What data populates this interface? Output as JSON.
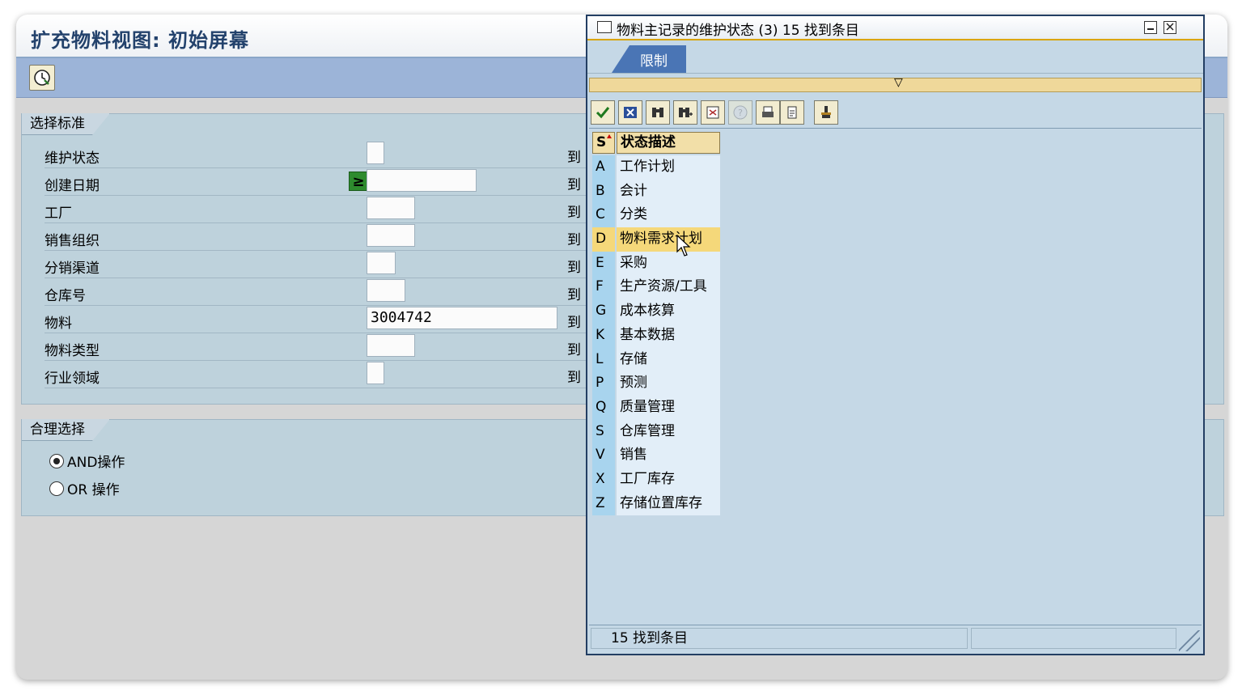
{
  "window": {
    "title": "扩充物料视图: 初始屏幕"
  },
  "toolbar": {
    "execute_icon": "clock-execute-icon"
  },
  "selection_criteria": {
    "group_title": "选择标准",
    "to_label": "到",
    "rows": [
      {
        "label": "维护状态",
        "value": ""
      },
      {
        "label": "创建日期",
        "value": "",
        "operator": "≥"
      },
      {
        "label": "工厂",
        "value": ""
      },
      {
        "label": "销售组织",
        "value": ""
      },
      {
        "label": "分销渠道",
        "value": ""
      },
      {
        "label": "仓库号",
        "value": ""
      },
      {
        "label": "物料",
        "value": "3004742"
      },
      {
        "label": "物料类型",
        "value": ""
      },
      {
        "label": "行业领域",
        "value": ""
      }
    ]
  },
  "logical_selection": {
    "group_title": "合理选择",
    "options": [
      {
        "label": "AND操作",
        "selected": true
      },
      {
        "label": "OR 操作",
        "selected": false
      }
    ]
  },
  "popup": {
    "title": "物料主记录的维护状态 (3)   15 找到条目",
    "tab": "限制",
    "columns": {
      "s": "S",
      "desc": "状态描述"
    },
    "rows": [
      {
        "s": "A",
        "desc": "工作计划"
      },
      {
        "s": "B",
        "desc": "会计"
      },
      {
        "s": "C",
        "desc": "分类"
      },
      {
        "s": "D",
        "desc": "物料需求计划",
        "selected": true
      },
      {
        "s": "E",
        "desc": "采购"
      },
      {
        "s": "F",
        "desc": "生产资源/工具"
      },
      {
        "s": "G",
        "desc": "成本核算"
      },
      {
        "s": "K",
        "desc": "基本数据"
      },
      {
        "s": "L",
        "desc": "存储"
      },
      {
        "s": "P",
        "desc": "预测"
      },
      {
        "s": "Q",
        "desc": "质量管理"
      },
      {
        "s": "S",
        "desc": "仓库管理"
      },
      {
        "s": "V",
        "desc": "销售"
      },
      {
        "s": "X",
        "desc": "工厂库存"
      },
      {
        "s": "Z",
        "desc": "存储位置库存"
      }
    ],
    "status": "15 找到条目",
    "toolbar_icons": [
      "check-icon",
      "cancel-icon",
      "find-icon",
      "find-next-icon",
      "filter-icon",
      "help-icon",
      "print-icon",
      "clipboard-icon",
      "settings-icon"
    ]
  },
  "colors": {
    "title_text": "#23426c",
    "toolbar_bg": "#9cb4d8",
    "group_bg": "#bed2dc",
    "selected_row": "#f5d87a",
    "tab_active": "#4a75b5"
  }
}
